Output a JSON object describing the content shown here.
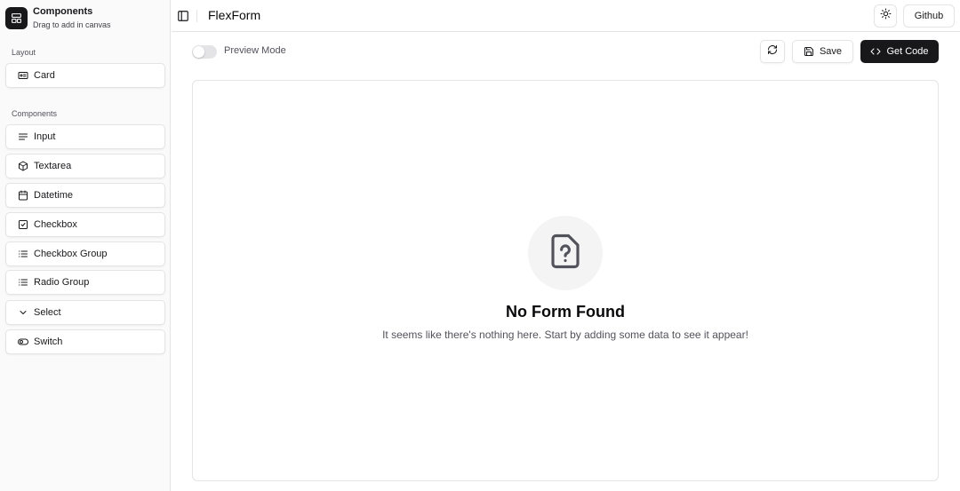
{
  "sidebar": {
    "title": "Components",
    "subtitle": "Drag to add in canvas",
    "sections": [
      {
        "label": "Layout"
      },
      {
        "label": "Components"
      }
    ],
    "layout_items": [
      {
        "label": "Card",
        "icon": "id-card-icon"
      }
    ],
    "component_items": [
      {
        "label": "Input",
        "icon": "text-lines-icon"
      },
      {
        "label": "Textarea",
        "icon": "box-icon"
      },
      {
        "label": "Datetime",
        "icon": "calendar-icon"
      },
      {
        "label": "Checkbox",
        "icon": "checkbox-icon"
      },
      {
        "label": "Checkbox Group",
        "icon": "list-icon"
      },
      {
        "label": "Radio Group",
        "icon": "list-icon"
      },
      {
        "label": "Select",
        "icon": "chevron-down-icon"
      },
      {
        "label": "Switch",
        "icon": "toggle-icon"
      }
    ]
  },
  "header": {
    "title": "FlexForm",
    "github_label": "Github"
  },
  "toolbar": {
    "preview_label": "Preview Mode",
    "preview_on": false,
    "save_label": "Save",
    "get_code_label": "Get Code"
  },
  "canvas": {
    "empty_title": "No Form Found",
    "empty_description": "It seems like there's nothing here. Start by adding some data to see it appear!"
  },
  "colors": {
    "primary": "#18181b",
    "border": "#e4e4e7",
    "sidebar_bg": "#fafafa",
    "muted": "#f4f4f5"
  }
}
